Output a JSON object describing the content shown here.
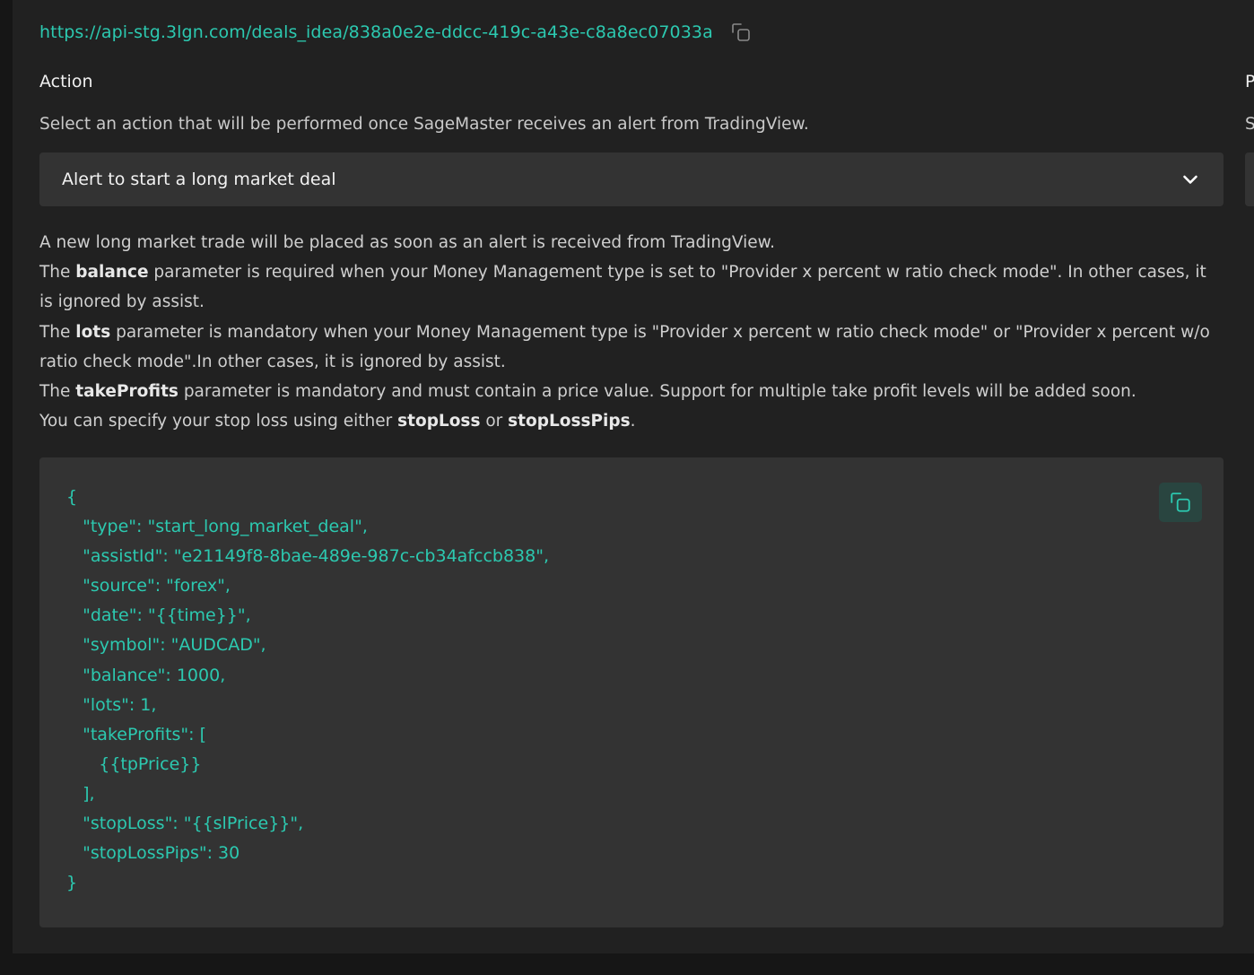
{
  "webhook": {
    "url": "https://api-stg.3lgn.com/deals_idea/838a0e2e-ddcc-419c-a43e-c8a8ec07033a",
    "copy_icon": "copy-icon"
  },
  "action": {
    "title": "Action",
    "subtitle": "Select an action that will be performed once SageMaster receives an alert from TradingView.",
    "selected": "Alert to start a long market deal"
  },
  "right_peek": {
    "title_initial": "P",
    "sub_initial": "S"
  },
  "description": {
    "line1": "A new long market trade will be placed as soon as an alert is received from TradingView.",
    "p2_pre": "The ",
    "p2_bold": "balance",
    "p2_post": " parameter is required when your Money Management type is set to \"Provider x percent w ratio check mode\". In other cases, it is ignored by assist.",
    "p3_pre": "The ",
    "p3_bold": "lots",
    "p3_post": " parameter is mandatory when your Money Management type is \"Provider x percent w ratio check mode\" or \"Provider x percent w/o ratio check mode\".In other cases, it is ignored by assist.",
    "p4_pre": "The ",
    "p4_bold": "takeProfits",
    "p4_post": " parameter is mandatory and must contain a price value. Support for multiple take profit levels will be added soon.",
    "p5_pre": "You can specify your stop loss using either ",
    "p5_bold1": "stopLoss",
    "p5_mid": " or ",
    "p5_bold2": "stopLossPips",
    "p5_post": "."
  },
  "code_lines": [
    "{",
    "   \"type\": \"start_long_market_deal\",",
    "   \"assistId\": \"e21149f8-8bae-489e-987c-cb34afccb838\",",
    "   \"source\": \"forex\",",
    "   \"date\": \"{{time}}\",",
    "   \"symbol\": \"AUDCAD\",",
    "   \"balance\": 1000,",
    "   \"lots\": 1,",
    "   \"takeProfits\": [",
    "      {{tpPrice}}",
    "   ],",
    "   \"stopLoss\": \"{{slPrice}}\",",
    "   \"stopLossPips\": 30",
    "}"
  ],
  "colors": {
    "accent": "#2cc9b0",
    "panel": "#212121",
    "field": "#333333",
    "copy_button_bg": "#294540"
  }
}
